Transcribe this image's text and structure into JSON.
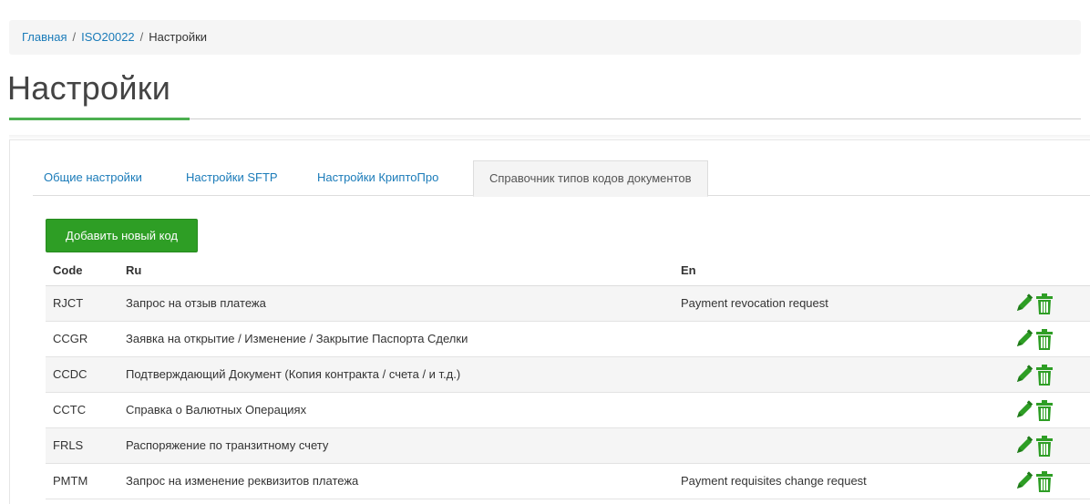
{
  "breadcrumb": {
    "items": [
      {
        "label": "Главная"
      },
      {
        "label": "ISO20022"
      }
    ],
    "separator": "/",
    "current": "Настройки"
  },
  "page": {
    "title": "Настройки"
  },
  "tabs": [
    {
      "label": "Общие настройки",
      "active": false
    },
    {
      "label": "Настройки SFTP",
      "active": false
    },
    {
      "label": "Настройки КриптоПро",
      "active": false
    },
    {
      "label": "Справочник типов кодов документов",
      "active": true
    }
  ],
  "toolbar": {
    "add_label": "Добавить новый код"
  },
  "table": {
    "columns": [
      "Code",
      "Ru",
      "En"
    ],
    "rows": [
      {
        "code": "RJCT",
        "ru": "Запрос на отзыв платежа",
        "en": "Payment revocation request"
      },
      {
        "code": "CCGR",
        "ru": "Заявка на открытие / Изменение / Закрытие Паспорта Сделки",
        "en": ""
      },
      {
        "code": "CCDC",
        "ru": "Подтверждающий Документ (Копия контракта / счета / и т.д.)",
        "en": ""
      },
      {
        "code": "CCTC",
        "ru": "Справка о Валютных Операциях",
        "en": ""
      },
      {
        "code": "FRLS",
        "ru": "Распоряжение по транзитному счету",
        "en": ""
      },
      {
        "code": "PMTM",
        "ru": "Запрос на изменение реквизитов платежа",
        "en": "Payment requisites change request"
      }
    ],
    "row_actions": [
      "pencil-icon",
      "trash-icon"
    ]
  },
  "colors": {
    "link": "#1a7bb9",
    "primary_button": "#2e9e25",
    "action_icons": "#2e9e25",
    "title_accent": "#4caf50"
  }
}
